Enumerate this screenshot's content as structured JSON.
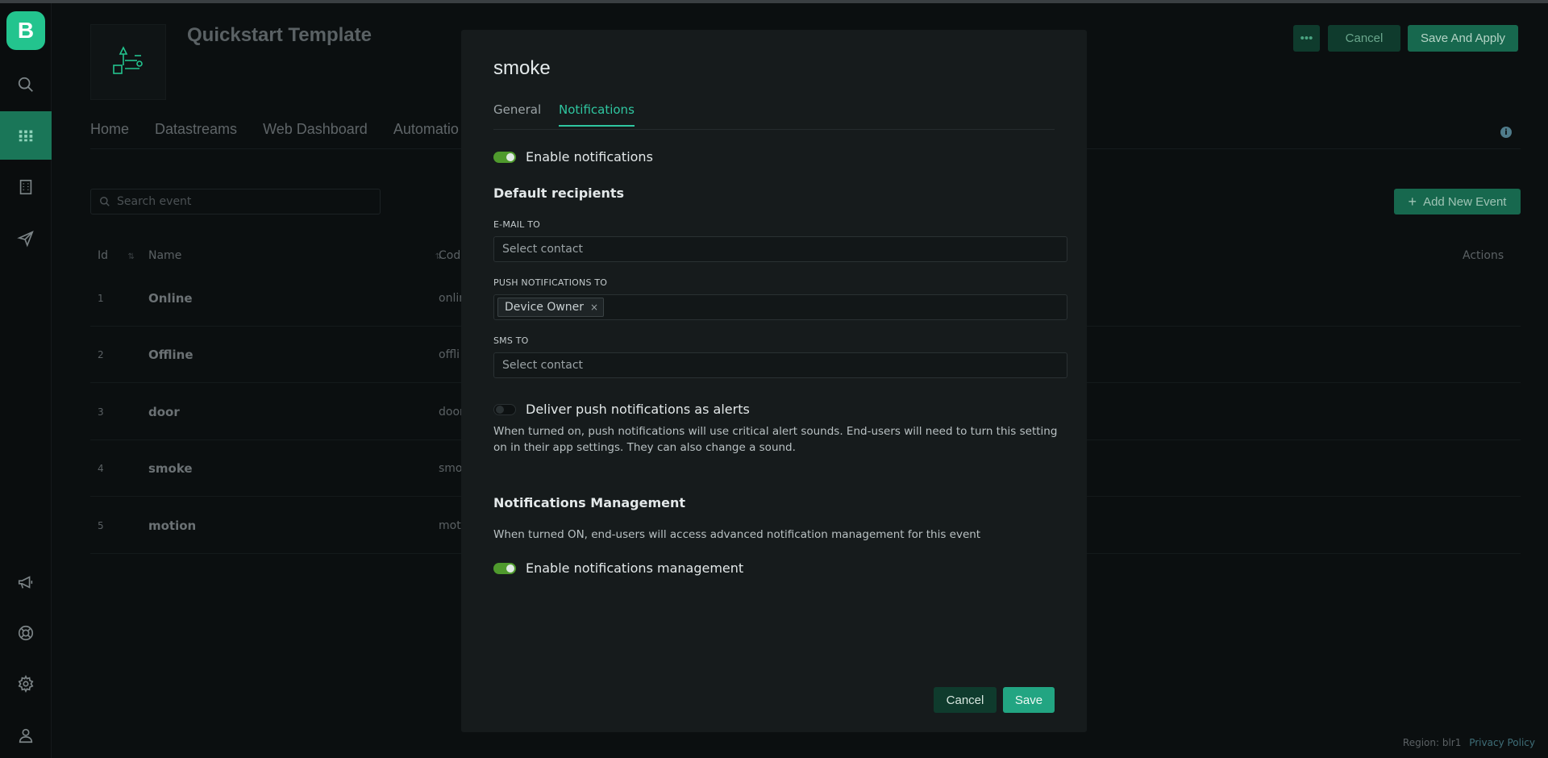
{
  "sidebar": {
    "logo_letter": "B",
    "items": [
      {
        "icon": "search-icon"
      },
      {
        "icon": "grid-icon",
        "active": true
      },
      {
        "icon": "building-icon"
      },
      {
        "icon": "send-icon"
      },
      {
        "icon": "megaphone-icon"
      },
      {
        "icon": "lifebuoy-icon"
      },
      {
        "icon": "gear-icon"
      },
      {
        "icon": "user-icon"
      }
    ]
  },
  "header": {
    "title": "Quickstart Template",
    "more_label": "•••",
    "cancel_label": "Cancel",
    "save_apply_label": "Save And Apply"
  },
  "nav": {
    "tabs": [
      "Home",
      "Datastreams",
      "Web Dashboard",
      "Automatio"
    ]
  },
  "events": {
    "search_placeholder": "Search event",
    "add_label": "Add New Event",
    "columns": {
      "id": "Id",
      "name": "Name",
      "code": "Code",
      "actions": "Actions"
    },
    "rows": [
      {
        "id": "1",
        "name": "Online",
        "code": "onlin"
      },
      {
        "id": "2",
        "name": "Offline",
        "code": "offli"
      },
      {
        "id": "3",
        "name": "door",
        "code": "door"
      },
      {
        "id": "4",
        "name": "smoke",
        "code": "smol"
      },
      {
        "id": "5",
        "name": "motion",
        "code": "moti"
      }
    ]
  },
  "footer": {
    "region": "Region: blr1",
    "privacy": "Privacy Policy"
  },
  "modal": {
    "title": "smoke",
    "tabs": [
      {
        "label": "General",
        "active": false
      },
      {
        "label": "Notifications",
        "active": true
      }
    ],
    "enable_notifications": {
      "label": "Enable notifications",
      "on": true
    },
    "recipients_heading": "Default recipients",
    "email": {
      "caption": "E-MAIL TO",
      "placeholder": "Select contact"
    },
    "push": {
      "caption": "PUSH NOTIFICATIONS TO",
      "chip": "Device Owner",
      "chip_remove": "×"
    },
    "sms": {
      "caption": "SMS TO",
      "placeholder": "Select contact"
    },
    "alerts": {
      "label": "Deliver push notifications as alerts",
      "on": false,
      "help": "When turned on, push notifications will use critical alert sounds. End-users will need to turn this setting on in their app settings. They can also change a sound."
    },
    "management": {
      "heading": "Notifications Management",
      "help": "When turned ON, end-users will access advanced notification management for this event",
      "toggle_label": "Enable notifications management",
      "on": true
    },
    "cancel_label": "Cancel",
    "save_label": "Save"
  },
  "colors": {
    "accent": "#23c48e",
    "toggle_on": "#4f9a2d",
    "tab_active": "#2fc6a0"
  }
}
